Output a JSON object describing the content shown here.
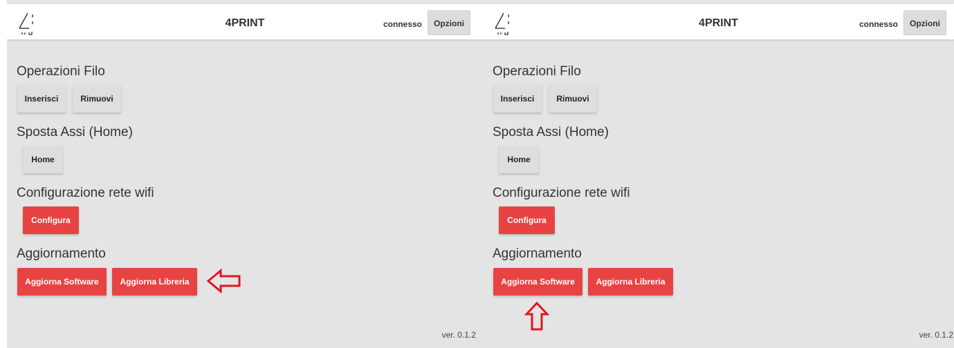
{
  "left_panel": {
    "header": {
      "title": "4PRINT",
      "status": "connesso",
      "options_label": "Opzioni"
    },
    "sections": {
      "filo_title": "Operazioni Filo",
      "inserisci_label": "Inserisci",
      "rimuovi_label": "Rimuovi",
      "assi_title": "Sposta Assi (Home)",
      "home_label": "Home",
      "wifi_title": "Configurazione rete wifi",
      "configura_label": "Configura",
      "update_title": "Aggiornamento",
      "update_software_label": "Aggiorna Software",
      "update_library_label": "Aggiorna Libreria"
    },
    "version": "ver. 0.1.2"
  },
  "right_panel": {
    "header": {
      "title": "4PRINT",
      "status": "connesso",
      "options_label": "Opzioni"
    },
    "sections": {
      "filo_title": "Operazioni Filo",
      "inserisci_label": "Inserisci",
      "rimuovi_label": "Rimuovi",
      "assi_title": "Sposta Assi (Home)",
      "home_label": "Home",
      "wifi_title": "Configurazione rete wifi",
      "configura_label": "Configura",
      "update_title": "Aggiornamento",
      "update_software_label": "Aggiorna Software",
      "update_library_label": "Aggiorna Libreria"
    },
    "version": "ver. 0.1.2"
  },
  "colors": {
    "background": "#e4e4e4",
    "header_background": "#ffffff",
    "primary_red": "#e84343",
    "grey_button": "#dedede",
    "annotation_arrow": "#e0161f"
  },
  "icons": {
    "logo": "4print-logo-icon",
    "left_annotation": "left-pointing-arrow-icon",
    "right_annotation": "up-pointing-arrow-icon"
  }
}
